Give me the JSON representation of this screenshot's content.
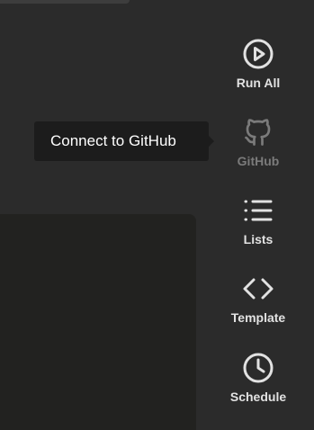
{
  "sidebar": {
    "items": [
      {
        "label": "Run All",
        "icon": "play-circle-icon"
      },
      {
        "label": "GitHub",
        "icon": "github-icon"
      },
      {
        "label": "Lists",
        "icon": "list-icon"
      },
      {
        "label": "Template",
        "icon": "code-brackets-icon"
      },
      {
        "label": "Schedule",
        "icon": "clock-icon"
      }
    ]
  },
  "tooltip": {
    "text": "Connect to GitHub"
  },
  "colors": {
    "background": "#2b2b2b",
    "panel": "#222220",
    "icon_active": "#e2e2e2",
    "icon_dim": "#7b7b7b",
    "tooltip_bg": "#1c1c1c"
  }
}
